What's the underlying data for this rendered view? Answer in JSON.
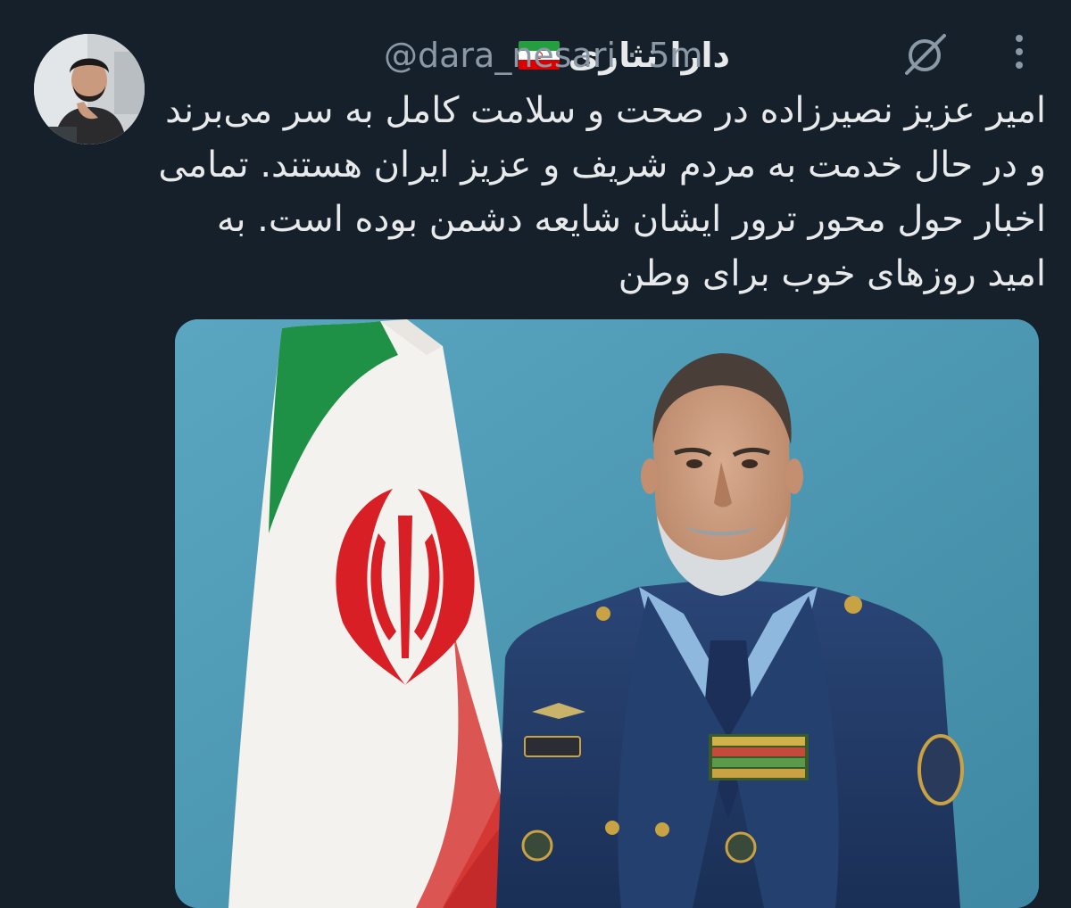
{
  "tweet": {
    "display_name": "دارا نثاری",
    "flag_icon": "iran-flag-icon",
    "handle": "@dara_nesari",
    "separator": "·",
    "time": "5m",
    "text_lines": [
      "امیر عزیز نصیرزاده در صحت و سلامت کامل به سر می‌برند",
      "و در حال خدمت به مردم شریف و عزیز ایران هستند. تمامی",
      "اخبار حول محور ترور ایشان شایعه دشمن بوده است. به",
      "امید روزهای خوب برای وطن"
    ],
    "media": {
      "description_icon": "portrait-photo-icon"
    }
  },
  "icons": {
    "grok": "grok-icon",
    "more": "more-options-icon"
  },
  "colors": {
    "background": "#15202b",
    "text_primary": "#e7e9ea",
    "text_secondary": "#8b98a5",
    "photo_backdrop": "#4c99b5",
    "uniform": "#1f3a66",
    "flag_green": "#239f40",
    "flag_red": "#da0000"
  }
}
